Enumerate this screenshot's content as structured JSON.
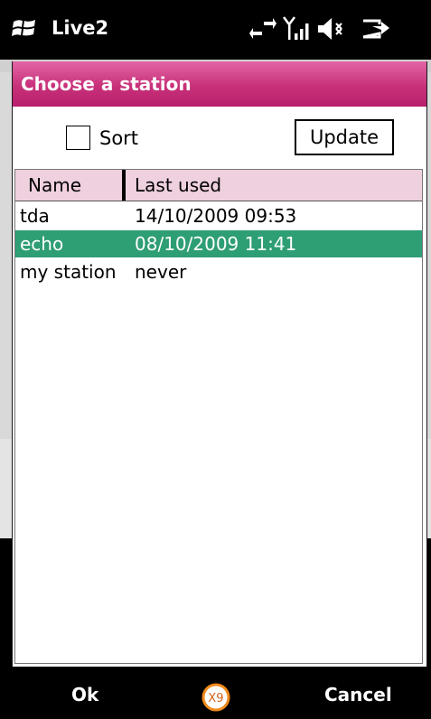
{
  "statusbar": {
    "app_title": "Live2",
    "icons": [
      "windows-start-icon",
      "data-connection-icon",
      "signal-strength-icon",
      "volume-muted-icon",
      "battery-charging-icon"
    ]
  },
  "dialog": {
    "title": "Choose a station",
    "sort_label": "Sort",
    "sort_checked": false,
    "update_label": "Update",
    "columns": [
      "Name",
      "Last used"
    ],
    "rows": [
      {
        "name": "tda",
        "last_used": "14/10/2009 09:53",
        "selected": false
      },
      {
        "name": "echo",
        "last_used": "08/10/2009 11:41",
        "selected": true
      },
      {
        "name": "my station",
        "last_used": "never",
        "selected": false
      }
    ]
  },
  "softkeys": {
    "left": "Ok",
    "right": "Cancel",
    "center_icon": "keyboard-input-icon",
    "center_text": "X9"
  },
  "colors": {
    "title_bar": "#c8317a",
    "header_bg": "#efd0df",
    "selection": "#2e9e74"
  }
}
